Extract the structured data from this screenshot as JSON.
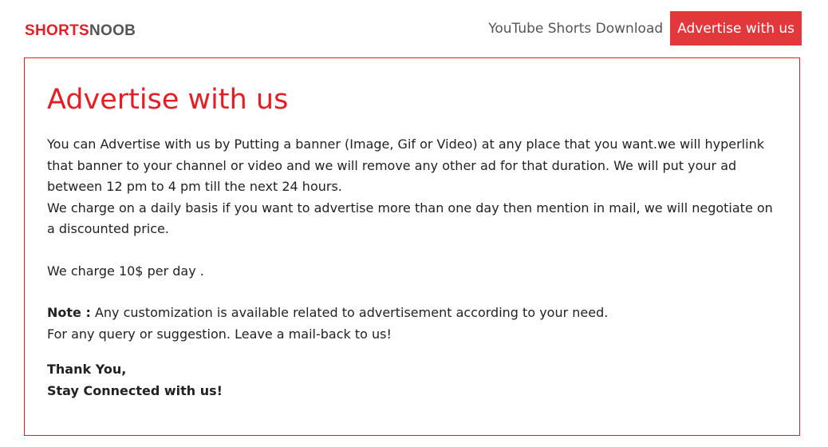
{
  "header": {
    "logo_part1": "SHORTS",
    "logo_part2": "NOOB",
    "nav": {
      "download_label": "YouTube Shorts Download",
      "advertise_label": "Advertise with us"
    }
  },
  "main": {
    "title": "Advertise with us",
    "paragraph1": "You can Advertise with us by Putting a banner (Image, Gif or Video) at any place that you want.we will hyperlink that banner to your channel or video and we will remove any other ad for that duration. We will put your ad between 12 pm to 4 pm till the next 24 hours.",
    "paragraph2": "We charge on a daily basis if you want to advertise more than one day then mention in mail, we will negotiate on a discounted price.",
    "price": "We charge 10$ per day .",
    "note_label": "Note :",
    "note_text": " Any customization is available related to advertisement according to your need.",
    "query": "For any query or suggestion. Leave a mail-back to us!",
    "thanks": "Thank You,",
    "stay_connected": "Stay Connected with us!"
  },
  "colors": {
    "accent": "#e31e24",
    "nav_active_bg": "#e3383b",
    "logo_gray": "#555555",
    "text": "#222222"
  }
}
